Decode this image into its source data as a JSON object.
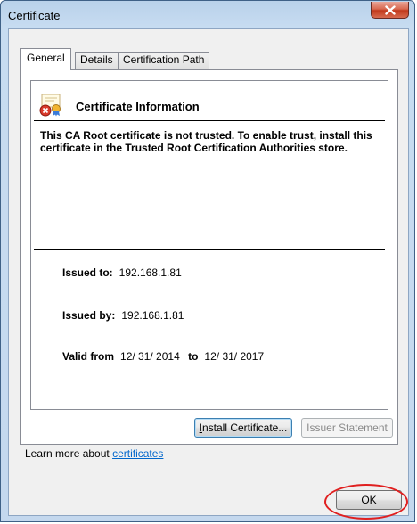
{
  "window": {
    "title": "Certificate"
  },
  "tabs": [
    {
      "label": "General"
    },
    {
      "label": "Details"
    },
    {
      "label": "Certification Path"
    }
  ],
  "info": {
    "heading": "Certificate Information",
    "warning": "This CA Root certificate is not trusted. To enable trust, install this certificate in the Trusted Root Certification Authorities store."
  },
  "fields": {
    "issued_to_label": "Issued to:",
    "issued_to_value": "192.168.1.81",
    "issued_by_label": "Issued by:",
    "issued_by_value": "192.168.1.81",
    "valid_from_label": "Valid from",
    "valid_from_value": "12/ 31/ 2014",
    "to_label": "to",
    "valid_to_value": "12/ 31/ 2017"
  },
  "buttons": {
    "install_certificate": "Install Certificate...",
    "issuer_statement": "Issuer Statement",
    "ok": "OK"
  },
  "learn_more": {
    "prefix": "Learn more about",
    "link": "certificates"
  },
  "colors": {
    "titlebar": "#c4d8ee",
    "close_button": "#c1391c",
    "link": "#0066cc",
    "annotation_circle": "#e02020"
  }
}
